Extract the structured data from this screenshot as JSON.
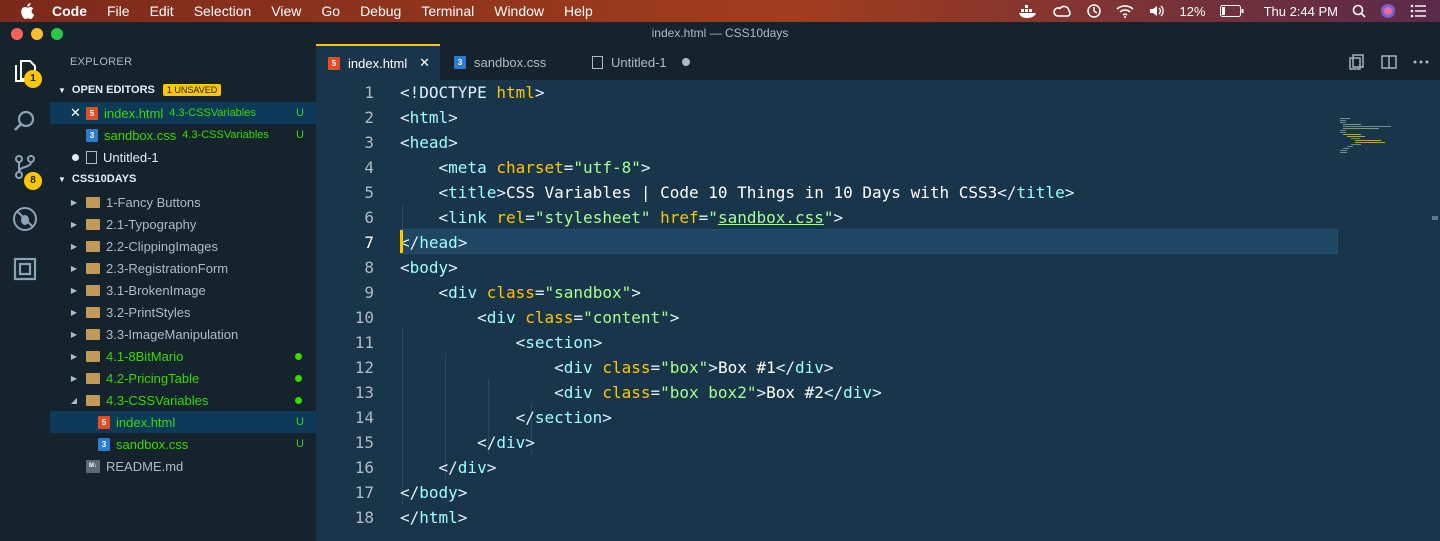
{
  "menubar": {
    "app": "Code",
    "items": [
      "File",
      "Edit",
      "Selection",
      "View",
      "Go",
      "Debug",
      "Terminal",
      "Window",
      "Help"
    ],
    "battery": "12%",
    "clock": "Thu 2:44 PM"
  },
  "window": {
    "title": "index.html — CSS10days"
  },
  "activity": {
    "explorer_badge": "1",
    "scm_badge": "8"
  },
  "sidebar": {
    "title": "EXPLORER",
    "open_editors": {
      "label": "OPEN EDITORS",
      "badge": "1 UNSAVED",
      "items": [
        {
          "name": "index.html",
          "folder": "4.3-CSSVariables",
          "status": "U",
          "icon": "html5-icon"
        },
        {
          "name": "sandbox.css",
          "folder": "4.3-CSSVariables",
          "status": "U",
          "icon": "css3-icon"
        },
        {
          "name": "Untitled-1",
          "folder": "",
          "status": "",
          "icon": "file-icon"
        }
      ]
    },
    "workspace": {
      "label": "CSS10DAYS",
      "items": [
        {
          "name": "1-Fancy Buttons"
        },
        {
          "name": "2.1-Typography"
        },
        {
          "name": "2.2-ClippingImages"
        },
        {
          "name": "2.3-RegistrationForm"
        },
        {
          "name": "3.1-BrokenImage"
        },
        {
          "name": "3.2-PrintStyles"
        },
        {
          "name": "3.3-ImageManipulation"
        },
        {
          "name": "4.1-8BitMario"
        },
        {
          "name": "4.2-PricingTable"
        },
        {
          "name": "4.3-CSSVariables"
        },
        {
          "name": "index.html",
          "status": "U"
        },
        {
          "name": "sandbox.css",
          "status": "U"
        },
        {
          "name": "README.md"
        }
      ]
    }
  },
  "tabs": [
    {
      "label": "index.html"
    },
    {
      "label": "sandbox.css"
    },
    {
      "label": "Untitled-1"
    }
  ],
  "code": {
    "line_numbers": [
      "1",
      "2",
      "3",
      "4",
      "5",
      "6",
      "7",
      "8",
      "9",
      "10",
      "11",
      "12",
      "13",
      "14",
      "15",
      "16",
      "17",
      "18"
    ],
    "current_line": "7",
    "t": {
      "doctype": "<!DOCTYPE",
      "html": "html",
      "head": "head",
      "meta": "meta",
      "charset": "charset",
      "utf8": "\"utf-8\"",
      "title": "title",
      "title_text": "CSS Variables | Code 10 Things in 10 Days with CSS3",
      "link": "link",
      "rel": "rel",
      "stylesheet": "\"stylesheet\"",
      "href": "href",
      "sandbox_css": "sandbox.css",
      "body": "body",
      "div": "div",
      "class": "class",
      "sandbox": "\"sandbox\"",
      "content": "\"content\"",
      "section": "section",
      "box": "\"box\"",
      "box_text": "Box #1",
      "box2": "\"box box2\"",
      "box2_text": "Box #2"
    }
  }
}
